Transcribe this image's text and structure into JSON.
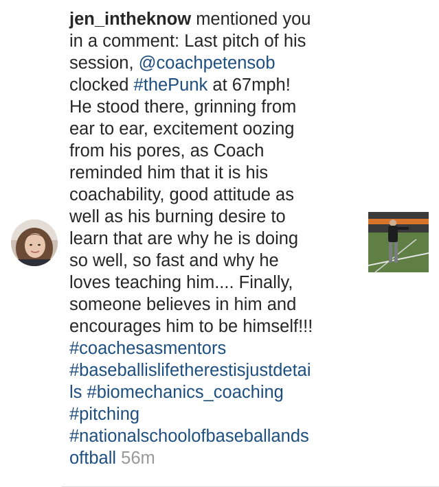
{
  "notification": {
    "username": "jen_intheknow",
    "action_text_1": " mentioned you",
    "action_text_2": "in a comment: Last pitch of his",
    "line3_prefix": "session, ",
    "mention": "@coachpetensob",
    "line4_prefix": "clocked ",
    "hashtag_thepunk": "#thePunk",
    "line4_suffix": " at 67mph!",
    "body_lines": [
      "He stood there, grinning from",
      "ear to ear, excitement oozing",
      "from his pores, as Coach",
      "reminded him that it is his",
      "coachability, good attitude as",
      "well as his burning desire to",
      "learn that are why he is doing",
      "so well, so fast and why he",
      "loves teaching him.... Finally,",
      "someone believes in him and",
      "encourages him to be himself!!!"
    ],
    "hashtags": {
      "coachesasmentors": "#coachesasmentors",
      "baseball_part1": "#baseballislifetherestisjustdetai",
      "baseball_part2": "ls",
      "biomechanics": "#biomechanics_coaching",
      "pitching": "#pitching",
      "national_part1": "#nationalschoolofbaseballands",
      "national_part2": "oftball"
    },
    "timestamp": "56m"
  },
  "icons": {
    "avatar": "user-avatar-photo",
    "thumbnail": "post-thumbnail-photo"
  },
  "colors": {
    "text": "#262626",
    "link": "#1c4e80",
    "timestamp": "#999999",
    "background": "#ffffff"
  }
}
